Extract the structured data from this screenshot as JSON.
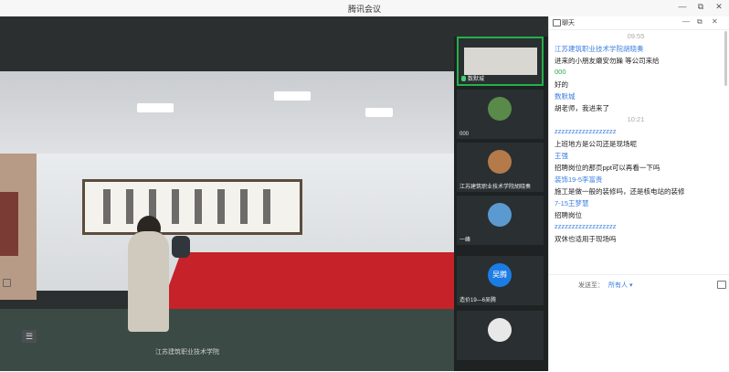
{
  "window": {
    "title": "腾讯会议",
    "btn_min": "—",
    "btn_restore": "⧉",
    "btn_close": "✕"
  },
  "stage": {
    "bottom_caption": "江苏建筑职业技术学院",
    "menu_icon": "☰"
  },
  "thumbnails": [
    {
      "label": "数默城",
      "active": true
    },
    {
      "label": "000",
      "active": false
    },
    {
      "label": "江苏建筑职业技术学院胡晓奏",
      "active": false
    },
    {
      "label": "一峰",
      "active": false
    },
    {
      "label": "造价19—6吴腾",
      "avatar_text": "吴腾",
      "active": false
    },
    {
      "label": "",
      "active": false
    }
  ],
  "chat": {
    "title": "聊天",
    "win_btns": [
      "—",
      "⧉",
      "✕"
    ],
    "messages": [
      {
        "type": "time",
        "text": "09:55"
      },
      {
        "type": "sender",
        "text": "江苏建筑职业技术学院胡晓奏"
      },
      {
        "type": "text",
        "text": "进来的小朋友癞安勿躁 等公司来给"
      },
      {
        "type": "sender_green",
        "text": "000"
      },
      {
        "type": "text",
        "text": "好的"
      },
      {
        "type": "sender",
        "text": "数默城"
      },
      {
        "type": "text",
        "text": "胡老师，我进来了"
      },
      {
        "type": "time",
        "text": "10:21"
      },
      {
        "type": "sender",
        "text": "zzzzzzzzzzzzzzzzzz"
      },
      {
        "type": "text",
        "text": "上班地方是公司还是现场呢"
      },
      {
        "type": "sender",
        "text": "王强"
      },
      {
        "type": "text",
        "text": "招聘岗位的那页ppt可以再看一下吗"
      },
      {
        "type": "sender",
        "text": "装饰19-5李富贵"
      },
      {
        "type": "text",
        "text": "施工是做一般的装修吗，还是核电站的装修"
      },
      {
        "type": "sender",
        "text": "7-15王梦慧"
      },
      {
        "type": "text",
        "text": "招聘岗位"
      },
      {
        "type": "sender",
        "text": "zzzzzzzzzzzzzzzzzz"
      },
      {
        "type": "text",
        "text": "双休也适用于现场吗"
      }
    ],
    "send_label": "发送至：",
    "send_target": "所有人 ▾"
  }
}
